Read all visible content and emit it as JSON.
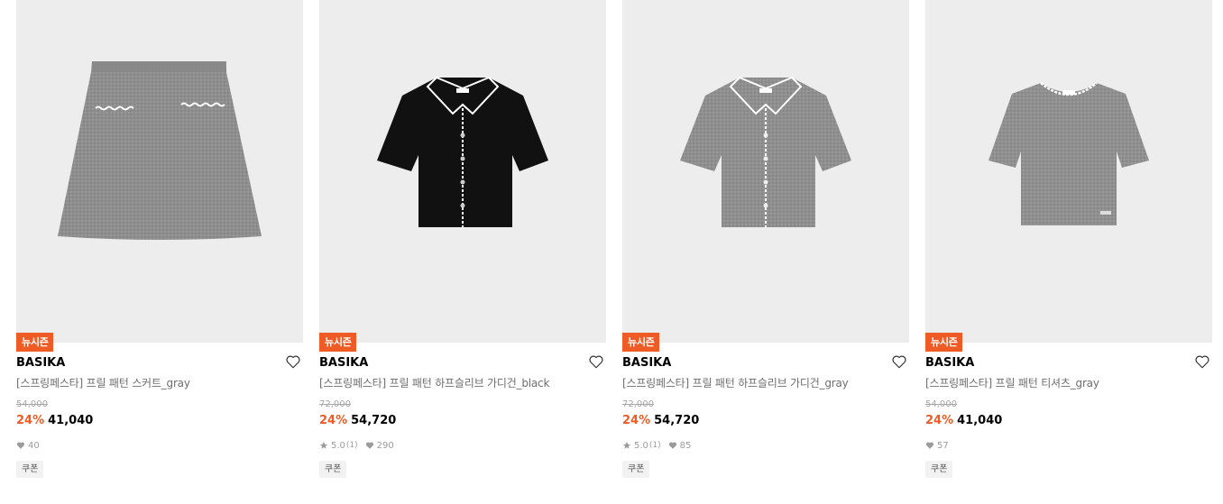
{
  "products": [
    {
      "badge": "뉴시즌",
      "brand": "BASIKA",
      "name": "[스프링페스타] 프릴 패턴 스커트_gray",
      "original_price": "54,000",
      "discount": "24%",
      "price": "41,040",
      "likes": "40",
      "coupon": "쿠폰",
      "image": "gray-knit-mini-skirt"
    },
    {
      "badge": "뉴시즌",
      "brand": "BASIKA",
      "name": "[스프링페스타] 프릴 패턴 하프슬리브 가디건_black",
      "original_price": "72,000",
      "discount": "24%",
      "price": "54,720",
      "rating": "5.0",
      "review_count": "(1)",
      "likes": "290",
      "coupon": "쿠폰",
      "image": "black-collared-half-sleeve-cardigan"
    },
    {
      "badge": "뉴시즌",
      "brand": "BASIKA",
      "name": "[스프링페스타] 프릴 패턴 하프슬리브 가디건_gray",
      "original_price": "72,000",
      "discount": "24%",
      "price": "54,720",
      "rating": "5.0",
      "review_count": "(1)",
      "likes": "85",
      "coupon": "쿠폰",
      "image": "gray-collared-half-sleeve-cardigan"
    },
    {
      "badge": "뉴시즌",
      "brand": "BASIKA",
      "name": "[스프링페스타] 프릴 패턴 티셔츠_gray",
      "original_price": "54,000",
      "discount": "24%",
      "price": "41,040",
      "likes": "57",
      "coupon": "쿠폰",
      "image": "gray-short-sleeve-knit-tshirt"
    }
  ],
  "colors": {
    "accent": "#ef5b24",
    "image_bg": "#ededed",
    "knit_gray": "#8e8e8e",
    "knit_black": "#111111"
  },
  "icons": [
    "heart-outline-icon",
    "star-icon",
    "heart-filled-icon"
  ]
}
